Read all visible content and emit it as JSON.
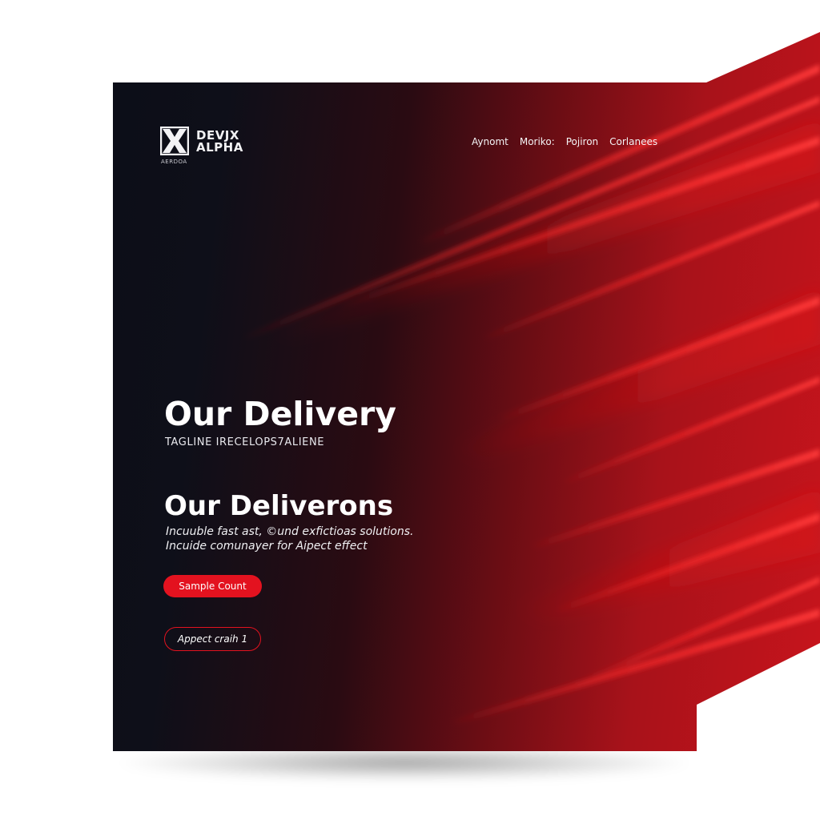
{
  "brand": {
    "line1": "DEVJX",
    "line2": "ALPHA",
    "subtext": "AERDOA"
  },
  "nav": {
    "items": [
      "Aynomt",
      "Moriko:",
      "Pojiron",
      "Corlanees"
    ]
  },
  "hero": {
    "title": "Our Delivery",
    "tagline": "TAGLINE IRECELOPS7ALIENE",
    "subtitle": "Our Deliverons",
    "description_line1": "Incuuble fast ast, ©und exfictioas solutions.",
    "description_line2": "Incuide comunayer for Aipect effect"
  },
  "buttons": {
    "primary_label": "Sample Count",
    "secondary_label": "Appect craih 1"
  },
  "colors": {
    "background_dark": "#0a0d16",
    "accent_red": "#e3121f",
    "deep_red": "#a8121a",
    "text_light": "#ffffff"
  },
  "icons": {
    "logo": "x-mark-logo-icon"
  }
}
